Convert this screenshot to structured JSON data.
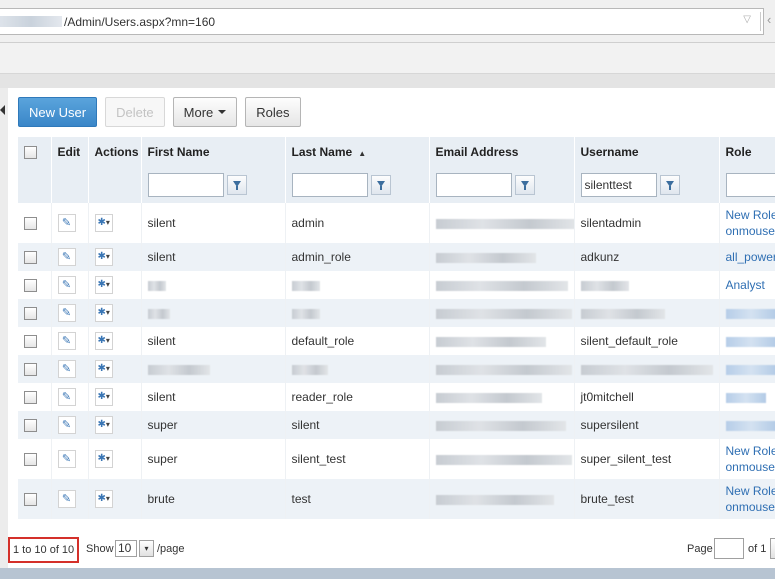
{
  "address_bar": {
    "url": "/Admin/Users.aspx?mn=160"
  },
  "toolbar": {
    "new_user": "New User",
    "delete": "Delete",
    "more": "More",
    "roles": "Roles"
  },
  "grid": {
    "columns": {
      "edit": "Edit",
      "actions": "Actions",
      "first_name": "First Name",
      "last_name": "Last Name",
      "email": "Email Address",
      "username": "Username",
      "role": "Role"
    },
    "sort": {
      "column": "last_name",
      "direction": "ascending"
    },
    "filters": {
      "first_name": "",
      "last_name": "",
      "email": "",
      "username": "silenttest",
      "role": ""
    },
    "rows": [
      {
        "first_name": "silent",
        "last_name": "admin",
        "username": "silentadmin",
        "role_line1": "New Role",
        "role_line2": "onmoused"
      },
      {
        "first_name": "silent",
        "last_name": "admin_role",
        "username": "adkunz",
        "role_line1": "all_powers",
        "role_line2": ""
      },
      {
        "first_name": "",
        "last_name": "",
        "username": "",
        "role_line1": "Analyst",
        "role_line2": ""
      },
      {
        "first_name": "",
        "last_name": "",
        "username": "",
        "role_line1": "",
        "role_line2": ""
      },
      {
        "first_name": "silent",
        "last_name": "default_role",
        "username": "silent_default_role",
        "role_line1": "",
        "role_line2": ""
      },
      {
        "first_name": "",
        "last_name": "",
        "username": "",
        "role_line1": "",
        "role_line2": ""
      },
      {
        "first_name": "silent",
        "last_name": "reader_role",
        "username": "jt0mitchell",
        "role_line1": "",
        "role_line2": ""
      },
      {
        "first_name": "super",
        "last_name": "silent",
        "username": "supersilent",
        "role_line1": "",
        "role_line2": ""
      },
      {
        "first_name": "super",
        "last_name": "silent_test",
        "username": "super_silent_test",
        "role_line1": "New Role",
        "role_line2": "onmoused"
      },
      {
        "first_name": "brute",
        "last_name": "test",
        "username": "brute_test",
        "role_line1": "New Role",
        "role_line2": "onmoused"
      }
    ]
  },
  "footer": {
    "record_count": "1 to 10 of 10",
    "show_label": "Show",
    "page_size": "10",
    "per_page_suffix": "/page",
    "page_label": "Page",
    "page_value": "",
    "page_of": "of 1"
  },
  "colors": {
    "primary_button": "#3a86c8",
    "header_bg": "#e8eef4",
    "alt_row_bg": "#edf2f7",
    "link": "#2f6fb3",
    "highlight_border": "#d4302a"
  }
}
